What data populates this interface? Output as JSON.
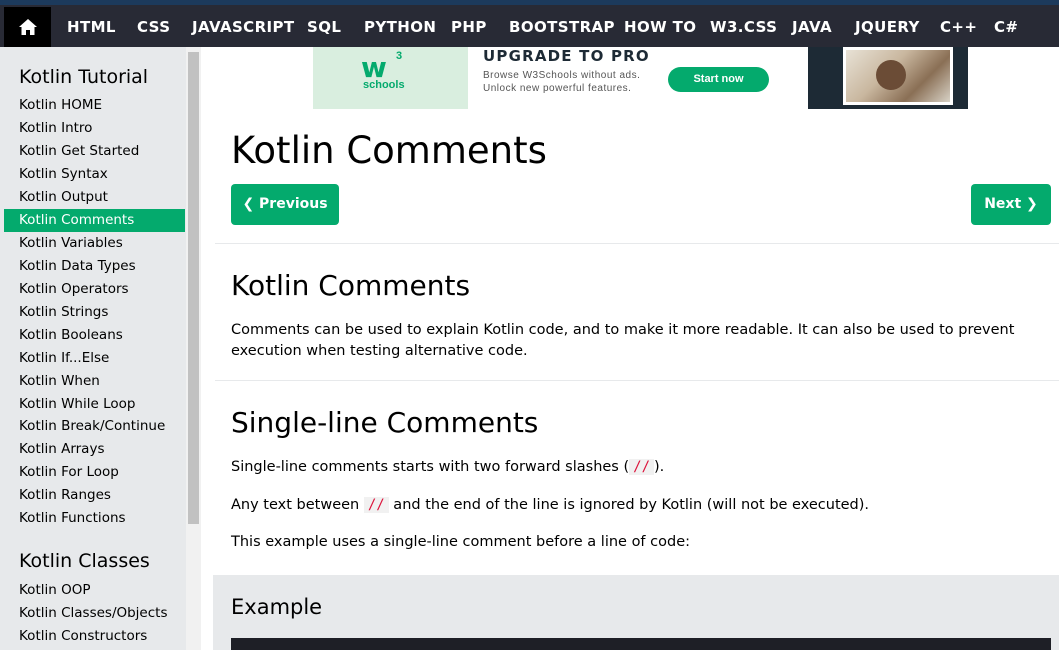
{
  "nav": {
    "home_icon": "home-icon",
    "items": [
      "HTML",
      "CSS",
      "JAVASCRIPT",
      "SQL",
      "PYTHON",
      "PHP",
      "BOOTSTRAP",
      "HOW TO",
      "W3.CSS",
      "JAVA",
      "JQUERY",
      "C++",
      "C#"
    ]
  },
  "sidebar": {
    "section1_title": "Kotlin Tutorial",
    "links": [
      "Kotlin HOME",
      "Kotlin Intro",
      "Kotlin Get Started",
      "Kotlin Syntax",
      "Kotlin Output",
      "Kotlin Comments",
      "Kotlin Variables",
      "Kotlin Data Types",
      "Kotlin Operators",
      "Kotlin Strings",
      "Kotlin Booleans",
      "Kotlin If...Else",
      "Kotlin When",
      "Kotlin While Loop",
      "Kotlin Break/Continue",
      "Kotlin Arrays",
      "Kotlin For Loop",
      "Kotlin Ranges",
      "Kotlin Functions"
    ],
    "active_link": "Kotlin Comments",
    "section2_title": "Kotlin Classes",
    "links2": [
      "Kotlin OOP",
      "Kotlin Classes/Objects",
      "Kotlin Constructors"
    ]
  },
  "ad": {
    "logo_w": "w",
    "logo_sup": "3",
    "logo_text": "schools",
    "title": "UPGRADE TO PRO",
    "line1": "Browse W3Schools without ads.",
    "line2": "Unlock new powerful features.",
    "button": "Start now"
  },
  "main": {
    "title": "Kotlin Comments",
    "prev_label": "❮ Previous",
    "next_label": "Next ❯",
    "section1_heading": "Kotlin Comments",
    "section1_text": "Comments can be used to explain Kotlin code, and to make it more readable. It can also be used to prevent execution when testing alternative code.",
    "section2_heading": "Single-line Comments",
    "p1_before": "Single-line comments starts with two forward slashes (",
    "p1_code": "//",
    "p1_after": ").",
    "p2_before": "Any text between ",
    "p2_code": "//",
    "p2_after": " and the end of the line is ignored by Kotlin (will not be executed).",
    "p3": "This example uses a single-line comment before a line of code:",
    "example_heading": "Example"
  },
  "colors": {
    "accent": "#04aa6d",
    "nav_bg": "#282a35",
    "sidebar_bg": "#e7e9eb",
    "code_red": "#dc143c"
  }
}
